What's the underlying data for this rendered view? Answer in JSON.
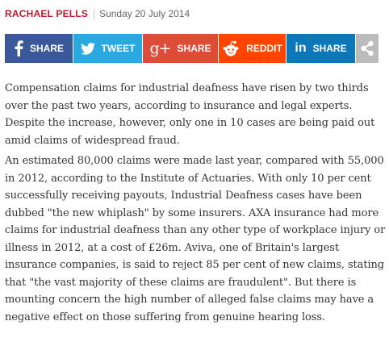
{
  "byline": {
    "author": "RACHAEL PELLS",
    "date": "Sunday 20 July 2014"
  },
  "share_buttons": [
    {
      "label": "SHARE",
      "icon": "facebook-icon",
      "color": "#3b5998"
    },
    {
      "label": "TWEET",
      "icon": "twitter-icon",
      "color": "#29a9e0"
    },
    {
      "label": "SHARE",
      "icon": "google-plus-icon",
      "color": "#dd4b39"
    },
    {
      "label": "REDDIT",
      "icon": "reddit-icon",
      "color": "#ff4500"
    },
    {
      "label": "SHARE",
      "icon": "linkedin-icon",
      "color": "#0d77b7"
    },
    {
      "label": "",
      "icon": "share-icon",
      "color": "#bbbbbb"
    }
  ],
  "article": {
    "paragraphs": [
      "Compensation claims for industrial deafness have risen by two thirds over the past two years, according to insurance and legal experts. Despite the increase, however, only one in 10 cases are being paid out amid claims of widespread fraud.",
      "An estimated 80,000 claims were made last year, compared with 55,000 in 2012, according to the Institute of Actuaries. With only 10 per cent successfully receiving payouts, Industrial Deafness cases have been dubbed \"the new whiplash\" by some insurers. AXA insurance had more claims for industrial deafness than any other type of workplace injury or illness in 2012, at a cost of £26m. Aviva, one of Britain's largest insurance companies, is said to reject 85 per cent of new claims, stating that \"the vast majority of these claims are fraudulent\". But there is mounting concern the high number of alleged false claims may have a negative effect on those suffering from genuine hearing loss."
    ]
  }
}
